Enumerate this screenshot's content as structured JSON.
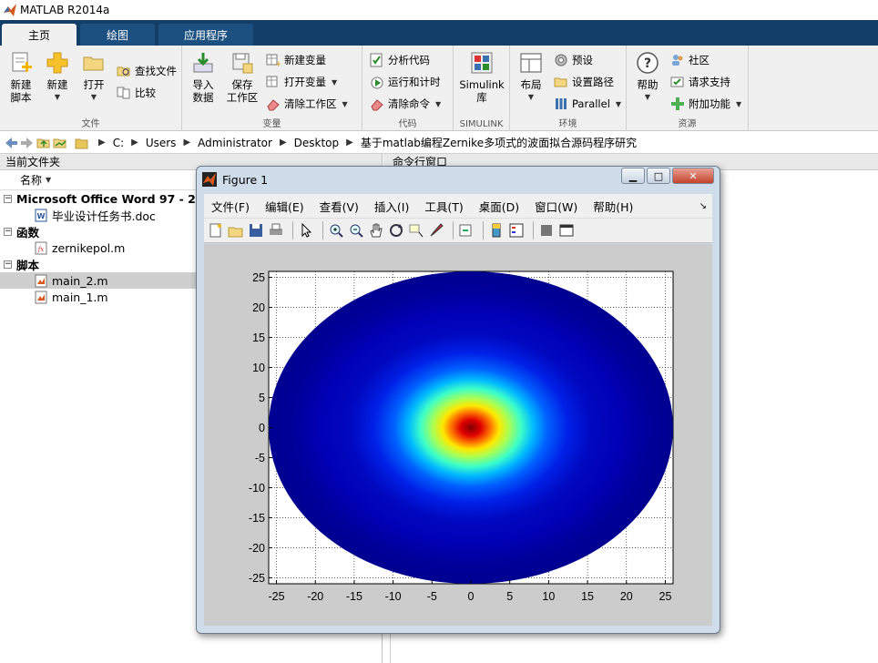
{
  "app": {
    "title": "MATLAB R2014a"
  },
  "tabs": [
    {
      "label": "主页",
      "active": true
    },
    {
      "label": "绘图",
      "active": false
    },
    {
      "label": "应用程序",
      "active": false
    }
  ],
  "ribbon": {
    "file": {
      "title": "文件",
      "new_script": "新建\n脚本",
      "new": "新建",
      "open": "打开",
      "find_files": "查找文件",
      "compare": "比较"
    },
    "variable": {
      "title": "变量",
      "import_data": "导入\n数据",
      "save_workspace": "保存\n工作区",
      "new_variable": "新建变量",
      "open_variable": "打开变量",
      "clear_workspace": "清除工作区"
    },
    "code": {
      "title": "代码",
      "analyze_code": "分析代码",
      "run_and_time": "运行和计时",
      "clear_commands": "清除命令"
    },
    "simulink": {
      "title": "SIMULINK",
      "library": "Simulink\n库"
    },
    "environment": {
      "title": "环境",
      "layout": "布局",
      "preferences": "预设",
      "set_path": "设置路径",
      "parallel": "Parallel"
    },
    "resources": {
      "title": "资源",
      "help": "帮助",
      "community": "社区",
      "request_support": "请求支持",
      "addons": "附加功能"
    }
  },
  "address": {
    "path": [
      "C:",
      "Users",
      "Administrator",
      "Desktop",
      "基于matlab编程Zernike多项式的波面拟合源码程序研究"
    ]
  },
  "current_folder": {
    "title": "当前文件夹",
    "column_name": "名称",
    "sections": [
      {
        "label": "Microsoft Office Word 97 - 2003",
        "items": [
          {
            "name": "毕业设计任务书.doc",
            "type": "doc",
            "selected": false
          }
        ]
      },
      {
        "label": "函数",
        "items": [
          {
            "name": "zernikepol.m",
            "type": "func",
            "selected": false
          }
        ]
      },
      {
        "label": "脚本",
        "items": [
          {
            "name": "main_2.m",
            "type": "m",
            "selected": true
          },
          {
            "name": "main_1.m",
            "type": "m",
            "selected": false
          }
        ]
      }
    ]
  },
  "command_window": {
    "title": "命令行窗口"
  },
  "figure": {
    "title": "Figure 1",
    "menus": [
      "文件(F)",
      "编辑(E)",
      "查看(V)",
      "插入(I)",
      "工具(T)",
      "桌面(D)",
      "窗口(W)",
      "帮助(H)"
    ],
    "toolbar_icons": [
      "new-figure-icon",
      "open-file-icon",
      "save-icon",
      "print-icon",
      "pointer-icon",
      "zoom-in-icon",
      "zoom-out-icon",
      "pan-icon",
      "rotate-3d-icon",
      "data-cursor-icon",
      "brush-icon",
      "link-icon",
      "colorbar-icon",
      "legend-icon",
      "hide-plot-tools-icon",
      "show-plot-tools-icon"
    ]
  },
  "chart_data": {
    "type": "heatmap",
    "title": "",
    "xlabel": "",
    "ylabel": "",
    "xlim": [
      -26,
      26
    ],
    "ylim": [
      -26,
      26
    ],
    "xticks": [
      -25,
      -20,
      -15,
      -10,
      -5,
      0,
      5,
      10,
      15,
      20,
      25
    ],
    "yticks": [
      -25,
      -20,
      -15,
      -10,
      -5,
      0,
      5,
      10,
      15,
      20,
      25
    ],
    "grid": true,
    "colormap": "jet",
    "peak_center": [
      0,
      0
    ],
    "aperture_radius": 26
  }
}
